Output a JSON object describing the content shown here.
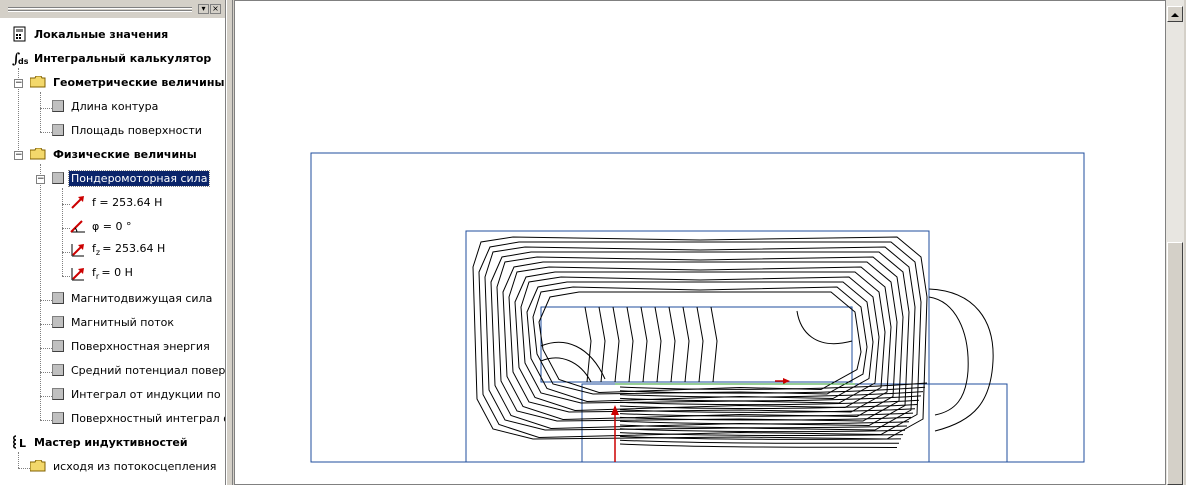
{
  "panel": {
    "tree": [
      {
        "label": "Локальные значения",
        "icon": "local-values-icon"
      },
      {
        "label": "Интегральный калькулятор",
        "icon": "integral-calculator-icon"
      },
      {
        "label": "Геометрические величины",
        "icon": "folder-icon"
      },
      {
        "label": "Длина контура",
        "icon": "square-item-icon"
      },
      {
        "label": "Площадь поверхности",
        "icon": "square-item-icon"
      },
      {
        "label": "Физические величины",
        "icon": "folder-icon"
      },
      {
        "label": "Пондеромоторная сила",
        "icon": "square-item-icon",
        "selected": true
      },
      {
        "label": "f = 253.64 Н",
        "icon": "force-vector-icon"
      },
      {
        "label": "φ = 0 °",
        "icon": "angle-icon"
      },
      {
        "label_base": "f",
        "label_sub": "z",
        "label_rest": "= 253.64 Н",
        "icon": "force-z-icon"
      },
      {
        "label_base": "f",
        "label_sub": "r",
        "label_rest": "= 0 Н",
        "icon": "force-r-icon"
      },
      {
        "label": "Магнитодвижущая сила",
        "icon": "square-item-icon"
      },
      {
        "label": "Магнитный поток",
        "icon": "square-item-icon"
      },
      {
        "label": "Поверхностная энергия",
        "icon": "square-item-icon"
      },
      {
        "label": "Средний потенциал поверхно",
        "icon": "square-item-icon"
      },
      {
        "label": "Интеграл от индукции по ком",
        "icon": "square-item-icon"
      },
      {
        "label": "Поверхностный интеграл от",
        "icon": "square-item-icon"
      },
      {
        "label": "Мастер индуктивностей",
        "icon": "inductance-wizard-icon"
      },
      {
        "label": "исходя из потокосцепления",
        "icon": "folder-icon"
      }
    ]
  },
  "plot": {
    "outline_color": "#1f4e9c",
    "contour_color": "#000000",
    "force_arrow_color": "#cc0000",
    "axis_line_color": "#cc0000"
  }
}
